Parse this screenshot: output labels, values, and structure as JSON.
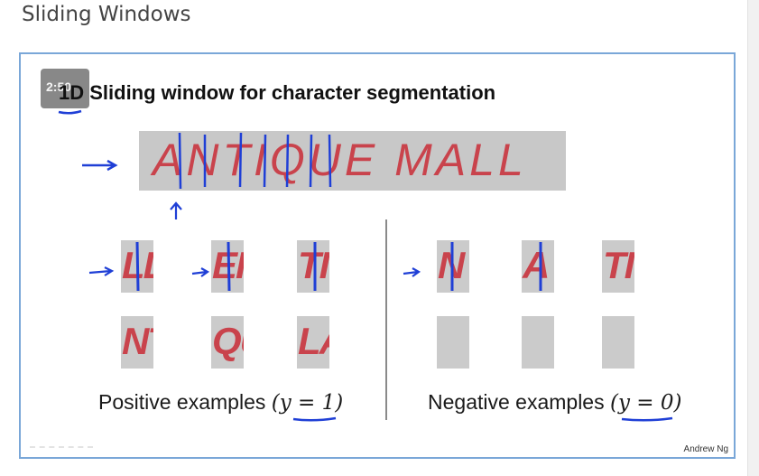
{
  "page": {
    "heading": "Sliding Windows"
  },
  "player": {
    "timer": "2:50"
  },
  "slide": {
    "title": "1D Sliding window for character segmentation",
    "banner_text": "ANTIQUE MALL",
    "credit": "Andrew Ng",
    "ink_color": "#1f3fd6",
    "text_color": "#c9434c"
  },
  "positive": {
    "caption_prefix": "Positive examples",
    "caption_math": "(y = 1)",
    "patches": [
      {
        "fragment": "LL"
      },
      {
        "fragment": "EI"
      },
      {
        "fragment": "TI"
      },
      {
        "fragment": "NT"
      },
      {
        "fragment": "QU"
      },
      {
        "fragment": "LA"
      }
    ]
  },
  "negative": {
    "caption_prefix": "Negative examples",
    "caption_math": "(y = 0)",
    "patches": [
      {
        "fragment": "N"
      },
      {
        "fragment": "A"
      },
      {
        "fragment": "TI"
      },
      {
        "fragment": ""
      },
      {
        "fragment": ""
      },
      {
        "fragment": ""
      }
    ]
  }
}
